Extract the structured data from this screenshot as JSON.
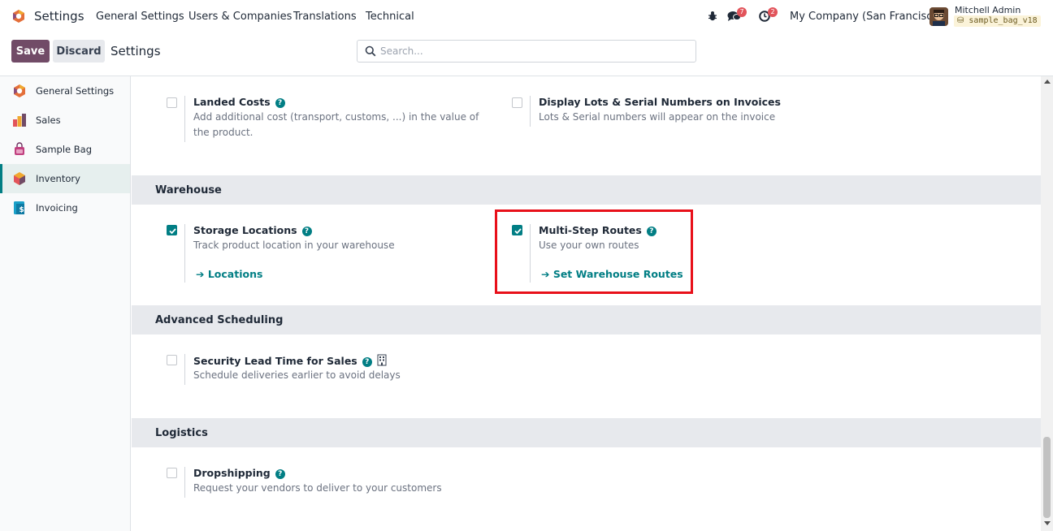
{
  "navbar": {
    "app_name": "Settings",
    "menu": [
      "General Settings",
      "Users & Companies",
      "Translations",
      "Technical"
    ],
    "messages_count": "7",
    "activities_count": "2",
    "company": "My Company (San Francisco)",
    "user_name": "Mitchell Admin",
    "database": "sample_bag_v18"
  },
  "control_panel": {
    "save_label": "Save",
    "discard_label": "Discard",
    "title": "Settings",
    "search_placeholder": "Search..."
  },
  "sidebar": {
    "items": [
      {
        "label": "General Settings",
        "icon": "general-settings-icon"
      },
      {
        "label": "Sales",
        "icon": "sales-icon"
      },
      {
        "label": "Sample Bag",
        "icon": "sample-bag-icon"
      },
      {
        "label": "Inventory",
        "icon": "inventory-icon",
        "active": true
      },
      {
        "label": "Invoicing",
        "icon": "invoicing-icon"
      }
    ]
  },
  "settings_top": {
    "landed_costs": {
      "title": "Landed Costs",
      "description": "Add additional cost (transport, customs, ...) in the value of the product.",
      "checked": false
    },
    "lots_serial": {
      "title": "Display Lots & Serial Numbers on Invoices",
      "description": "Lots & Serial numbers will appear on the invoice",
      "checked": false
    }
  },
  "warehouse": {
    "heading": "Warehouse",
    "storage_locations": {
      "title": "Storage Locations",
      "description": "Track product location in your warehouse",
      "link": "Locations",
      "checked": true
    },
    "multi_step_routes": {
      "title": "Multi-Step Routes",
      "description": "Use your own routes",
      "link": "Set Warehouse Routes",
      "checked": true
    }
  },
  "advanced_scheduling": {
    "heading": "Advanced Scheduling",
    "security_lead_time": {
      "title": "Security Lead Time for Sales",
      "description": "Schedule deliveries earlier to avoid delays",
      "checked": false
    }
  },
  "logistics": {
    "heading": "Logistics",
    "dropshipping": {
      "title": "Dropshipping",
      "description": "Request your vendors to deliver to your customers",
      "checked": false
    }
  },
  "colors": {
    "primary": "#714b67",
    "accent": "#017e84",
    "highlight": "#e8101a",
    "badge": "#e2545b"
  }
}
